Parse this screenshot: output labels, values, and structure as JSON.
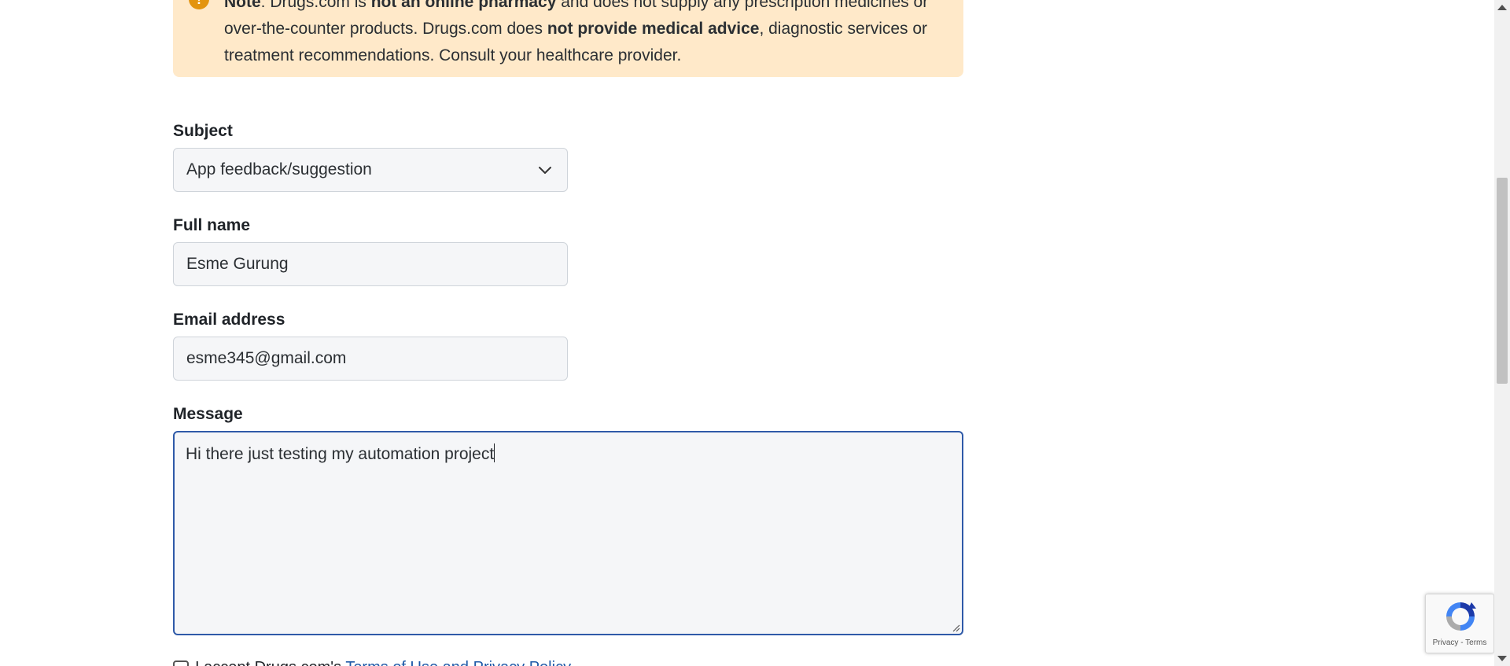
{
  "note": {
    "label": "Note",
    "text_1": ": Drugs.com is ",
    "bold_1": "not an online pharmacy",
    "text_2": " and does not supply any prescription medicines or",
    "line_2a": "over-the-counter products. Drugs.com does ",
    "bold_2": "not provide medical advice",
    "line_2b": ", diagnostic services or",
    "line_3": "treatment recommendations. Consult your healthcare provider."
  },
  "form": {
    "subject_label": "Subject",
    "subject_value": "App feedback/suggestion",
    "fullname_label": "Full name",
    "fullname_value": "Esme Gurung",
    "email_label": "Email address",
    "email_value": "esme345@gmail.com",
    "message_label": "Message",
    "message_value": "Hi there just testing my automation project",
    "agree_text": "I accept Drugs.com's ",
    "agree_link": "Terms of Use and Privacy Policy"
  },
  "recaptcha": {
    "privacy": "Privacy",
    "sep": " - ",
    "terms": "Terms"
  },
  "colors": {
    "note_bg": "#ffe9c9",
    "warning_icon": "#e3940f",
    "focus_border": "#2f5aa8",
    "input_bg": "#f5f6f8"
  }
}
